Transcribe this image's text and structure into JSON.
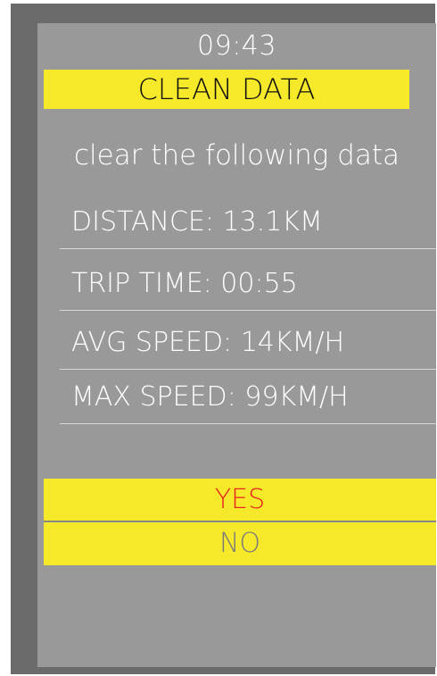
{
  "status_bar": {
    "time": "09:43"
  },
  "header": {
    "title": "CLEAN DATA"
  },
  "prompt": {
    "text": "clear the following data"
  },
  "stats": [
    {
      "label": "DISTANCE: 13.1KM"
    },
    {
      "label": "TRIP TIME: 00:55"
    },
    {
      "label": "AVG SPEED: 14KM/H"
    },
    {
      "label": "MAX SPEED: 99KM/H"
    }
  ],
  "options": {
    "yes_label": "YES",
    "no_label": "NO"
  },
  "colors": {
    "bezel": "#6b6b6b",
    "screen": "#999999",
    "highlight": "#f6e929",
    "yes_text": "#e6261f",
    "no_text": "#7a7a7a"
  }
}
